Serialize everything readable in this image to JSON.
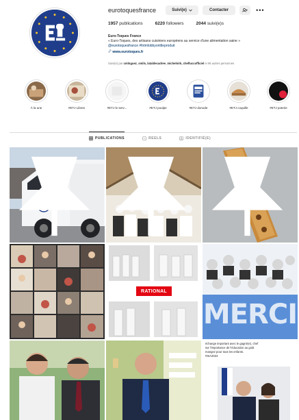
{
  "profile": {
    "username": "eurotoquesfrance",
    "follow_label": "Suivi(e)",
    "contact_label": "Contacter",
    "posts_count": "1957",
    "posts_label": "publications",
    "followers_count": "6220",
    "followers_label": "followers",
    "following_count": "2044",
    "following_label": "suivi(e)s",
    "display_name": "Euro-Toques France",
    "bio_line": "« Euro-Toques, des artisans cuisiniers européens au service d'une alimentation saine »",
    "bio_tags": "@eurotoquesfrance #fotmlobbyonttleproduit",
    "website": "www.eurotoques.fr",
    "followed_by_prefix": "Suivi(e) par",
    "followed_by_names": "cmlnguez_smils, lataldecadree_michelnirk, chefluccofficiel",
    "followed_by_suffix": "et 95 autres personnes"
  },
  "highlights": [
    {
      "label": "À la une"
    },
    {
      "label": "#ETJ Libres"
    },
    {
      "label": "#ETJ le serv..."
    },
    {
      "label": "#ETJ poulpe"
    },
    {
      "label": "#ETJ donode"
    },
    {
      "label": "#ETJ coquille"
    },
    {
      "label": "#ETJ poterie"
    }
  ],
  "tabs": [
    {
      "label": "PUBLICATIONS"
    },
    {
      "label": "REELS"
    },
    {
      "label": "IDENTIFIÉ(E)"
    }
  ],
  "posts": {
    "rational_label": "RATIONAL",
    "merci_label": "MERCI",
    "text_post_lines": [
      "échange important avec le gagné(e), chef",
      "sur l'importance de l'éducation au goût",
      "mangez pour tous les enfants.",
      "#SIA2024"
    ]
  },
  "colors": {
    "accent_link": "#00376b",
    "button_bg": "#efefef",
    "brand_blue": "#1f3d8a"
  }
}
